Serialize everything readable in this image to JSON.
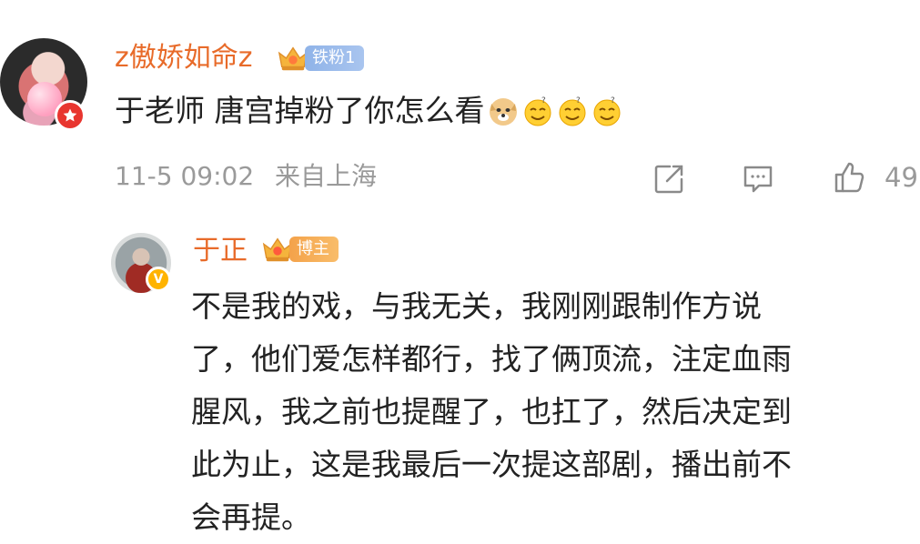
{
  "comment": {
    "username": "z傲娇如命z",
    "fan_badge": "铁粉1",
    "text": "于老师 唐宫掉粉了你怎么看",
    "emojis": [
      "doge-emoji",
      "smirk-emoji",
      "smirk-emoji",
      "smirk-emoji"
    ],
    "timestamp": "11-5 09:02",
    "location": "来自上海",
    "like_count": "49"
  },
  "reply": {
    "username": "于正",
    "role_badge": "博主",
    "text": "不是我的戏，与我无关，我刚刚跟制作方说\n了，他们爱怎样都行，找了俩顶流，注定血雨\n腥风，我之前也提醒了，也扛了，然后决定到\n此为止，这是我最后一次提这部剧，播出前不\n会再提。"
  },
  "colors": {
    "username": "#e86b2a",
    "meta_text": "#9a9a9a",
    "fan_badge": "#9dbbec",
    "blogger_badge": "#f5a64f"
  }
}
